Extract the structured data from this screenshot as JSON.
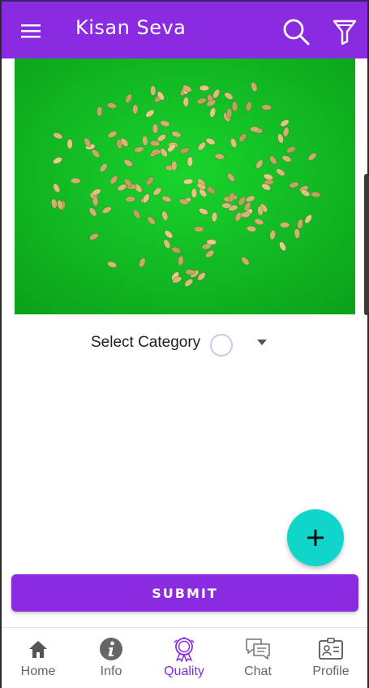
{
  "app_bar": {
    "title": "Kisan Seva",
    "background": "#8a2be2",
    "icons": [
      "menu-icon",
      "search-icon",
      "filter-icon"
    ]
  },
  "image": {
    "subject": "seed-sample-photo",
    "background": "#0fbf21"
  },
  "category": {
    "label": "Select Category",
    "icon": "dropdown-arrow-icon"
  },
  "fab": {
    "icon": "plus-icon",
    "symbol": "+",
    "color": "#10d6c9"
  },
  "submit": {
    "label": "SUBMIT",
    "color": "#8a2be2"
  },
  "bottom_nav": {
    "active": "Quality",
    "items": [
      {
        "label": "Home",
        "icon": "home-icon"
      },
      {
        "label": "Info",
        "icon": "info-icon"
      },
      {
        "label": "Quality",
        "icon": "quality-badge-icon"
      },
      {
        "label": "Chat",
        "icon": "chat-icon"
      },
      {
        "label": "Profile",
        "icon": "profile-card-icon"
      }
    ]
  }
}
